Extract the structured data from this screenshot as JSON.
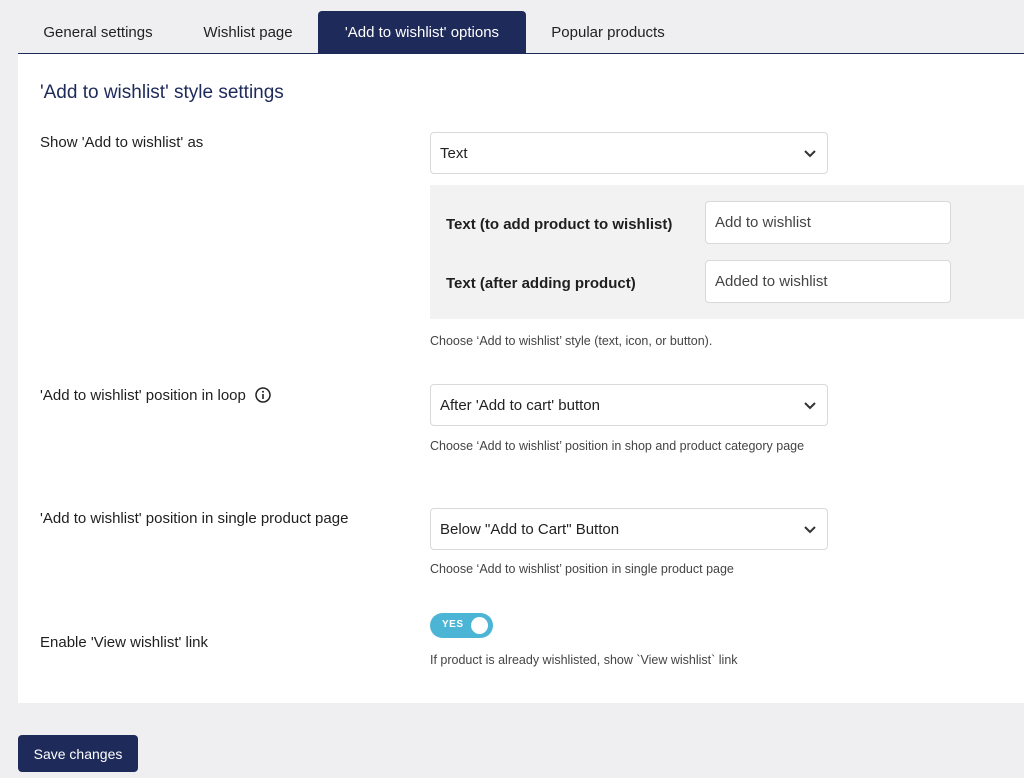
{
  "tabs": [
    {
      "label": "General settings",
      "active": false
    },
    {
      "label": "Wishlist page",
      "active": false
    },
    {
      "label": "'Add to wishlist' options",
      "active": true
    },
    {
      "label": "Popular products",
      "active": false
    }
  ],
  "section_title": "'Add to wishlist' style settings",
  "show_as": {
    "label": "Show 'Add to wishlist' as",
    "selected": "Text",
    "text_add_label": "Text (to add product to wishlist)",
    "text_add_value": "Add to wishlist",
    "text_after_label": "Text (after adding product)",
    "text_after_value": "Added to wishlist",
    "hint": "Choose ‘Add to wishlist’ style (text, icon, or button)."
  },
  "position_loop": {
    "label": "'Add to wishlist' position in loop",
    "selected": "After 'Add to cart' button",
    "hint": "Choose ‘Add to wishlist’ position in shop and product category page"
  },
  "position_single": {
    "label": "'Add to wishlist' position in single product page",
    "selected": "Below \"Add to Cart\" Button",
    "hint": "Choose ‘Add to wishlist’ position in single product page"
  },
  "view_link": {
    "label": "Enable 'View wishlist' link",
    "toggle_text": "YES",
    "enabled": true,
    "hint": "If product is already wishlisted, show `View wishlist` link"
  },
  "save_label": "Save changes",
  "colors": {
    "accent": "#1e2a5a",
    "toggle_on": "#4cb5d6",
    "page_bg": "#efeff1"
  }
}
